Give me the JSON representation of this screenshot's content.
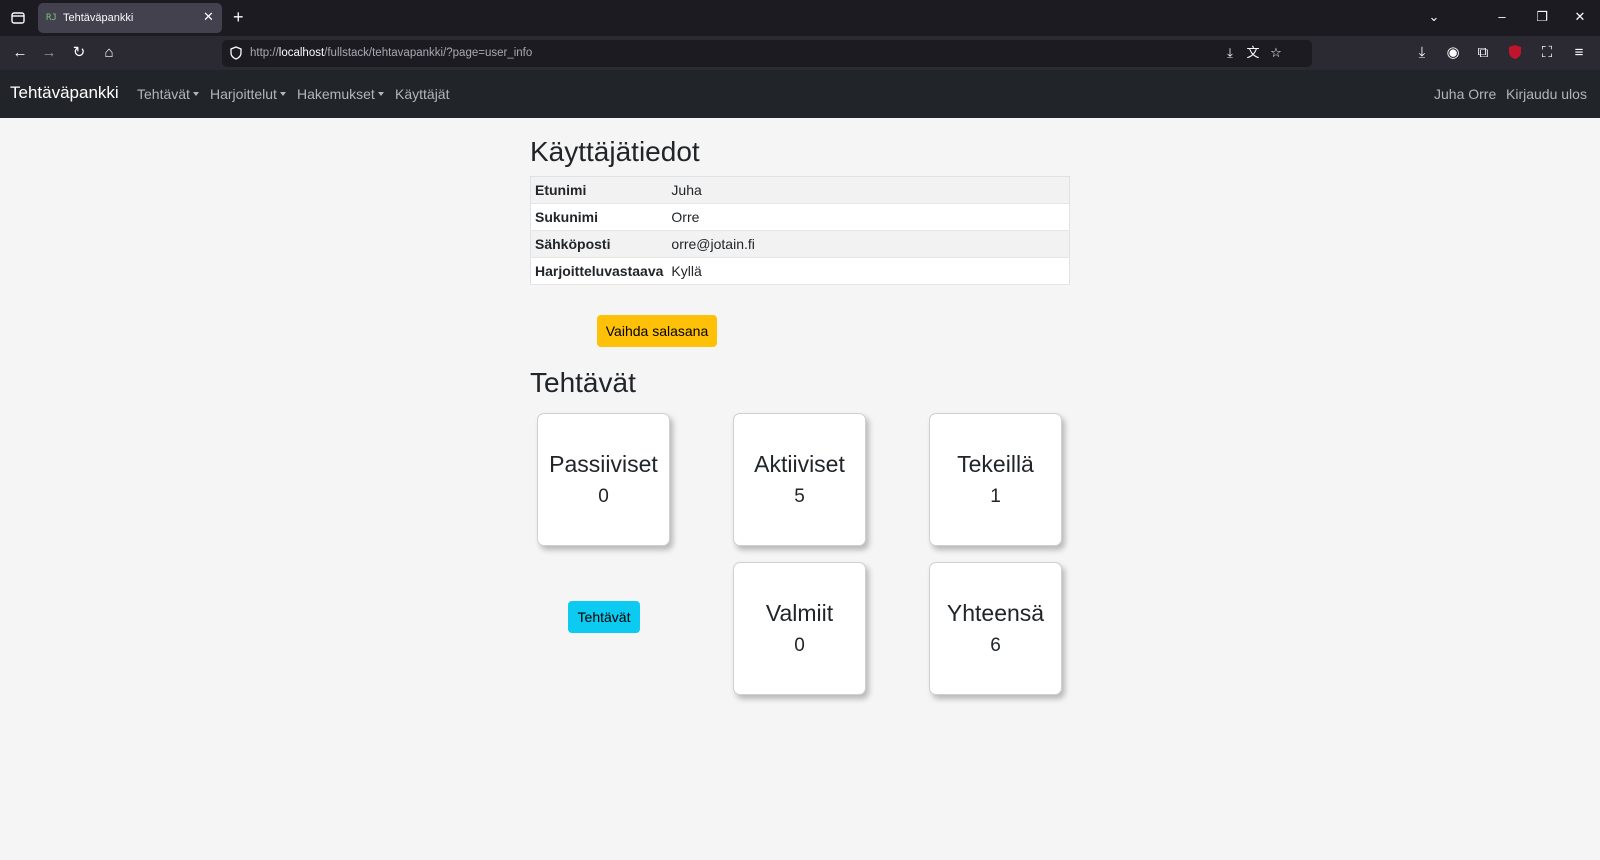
{
  "browser": {
    "tab_title": "Tehtäväpankki",
    "tab_favicon": "RJ",
    "url_scheme": "http://",
    "url_host": "localhost",
    "url_path": "/fullstack/tehtavapankki/?page=user_info"
  },
  "nav": {
    "brand": "Tehtäväpankki",
    "items": [
      {
        "label": "Tehtävät",
        "dropdown": true
      },
      {
        "label": "Harjoittelut",
        "dropdown": true
      },
      {
        "label": "Hakemukset",
        "dropdown": true
      },
      {
        "label": "Käyttäjät",
        "dropdown": false
      }
    ],
    "user_name": "Juha Orre",
    "logout": "Kirjaudu ulos"
  },
  "user_info": {
    "title": "Käyttäjätiedot",
    "rows": [
      {
        "label": "Etunimi",
        "value": "Juha"
      },
      {
        "label": "Sukunimi",
        "value": "Orre"
      },
      {
        "label": "Sähköposti",
        "value": "orre@jotain.fi"
      },
      {
        "label": "Harjoitteluvastaava",
        "value": "Kyllä"
      }
    ],
    "change_password_button": "Vaihda salasana"
  },
  "tasks": {
    "title": "Tehtävät",
    "button": "Tehtävät",
    "cards": [
      {
        "label": "Passiiviset",
        "count": "0"
      },
      {
        "label": "Aktiiviset",
        "count": "5"
      },
      {
        "label": "Tekeillä",
        "count": "1"
      },
      {
        "label": "Valmiit",
        "count": "0"
      },
      {
        "label": "Yhteensä",
        "count": "6"
      }
    ]
  },
  "colors": {
    "navbar_bg": "#212529",
    "warning": "#ffc107",
    "info": "#0dcaf0",
    "page_bg": "#f5f5f5"
  }
}
